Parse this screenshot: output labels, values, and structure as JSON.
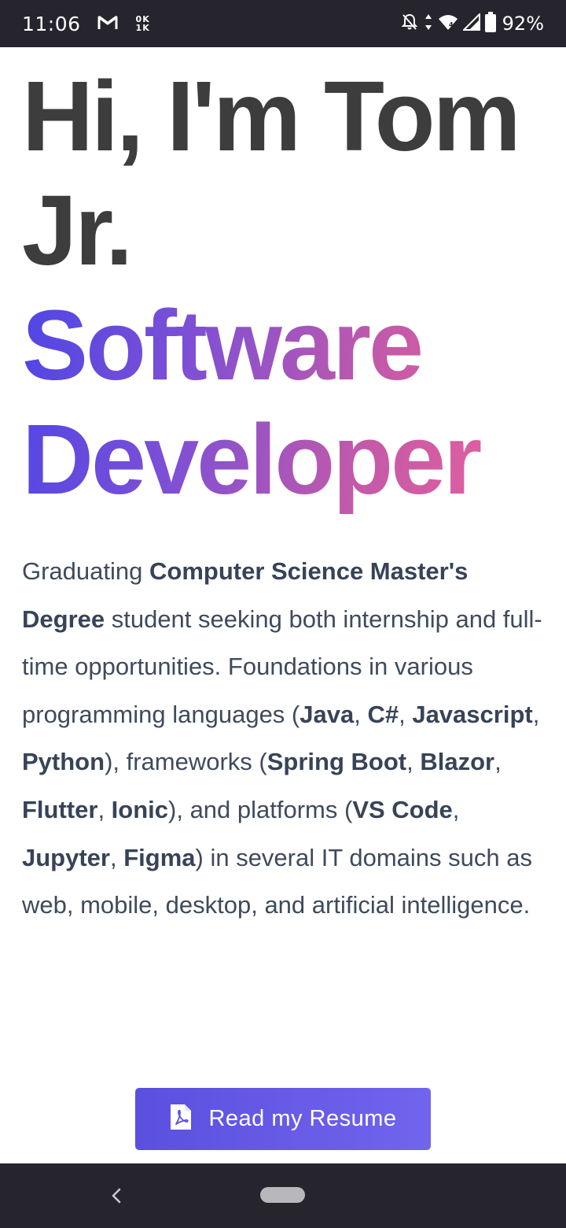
{
  "status_bar": {
    "time": "11:06",
    "left_icons": [
      "gmail-icon",
      "data-counter-icon"
    ],
    "data_counter": {
      "upload": "0K",
      "download": "1K"
    },
    "right_icons": [
      "notifications-off-icon",
      "data-transfer-icon",
      "wifi-icon",
      "cell-signal-icon",
      "battery-icon"
    ],
    "battery_percent": "92%"
  },
  "hero": {
    "title": "Hi, I'm Tom Jr.",
    "subtitle_line1": "Software",
    "subtitle_line2": "Developer",
    "gradient_colors": [
      "#4f46e5",
      "#7c4fd6",
      "#c45aa8",
      "#f0619a"
    ]
  },
  "intro": {
    "t1": "Graduating ",
    "b1": "Computer Science Master's Degree",
    "t2": " student seeking both internship and full-time opportunities. Foundations in various programming languages (",
    "b2": "Java",
    "t3": ", ",
    "b3": "C#",
    "t4": ", ",
    "b4": "Javascript",
    "t5": ", ",
    "b5": "Python",
    "t6": "), frameworks (",
    "b6": "Spring Boot",
    "t7": ", ",
    "b7": "Blazor",
    "t8": ", ",
    "b8": "Flutter",
    "t9": ", ",
    "b9": "Ionic",
    "t10": "), and platforms (",
    "b10": "VS Code",
    "t11": ", ",
    "b11": "Jupyter",
    "t12": ", ",
    "b12": "Figma",
    "t13": ") in several IT domains such as web, mobile, desktop, and artificial intelligence."
  },
  "resume_button": {
    "label": "Read my Resume",
    "icon": "pdf-file-icon",
    "color": "#5b4fe0"
  },
  "nav_bar": {
    "icons": [
      "back-icon",
      "home-pill-icon"
    ]
  },
  "colors": {
    "status_bar_bg": "#26252e",
    "title_text": "#3d3d3d",
    "body_text": "#3f4a5c",
    "page_bg": "#ffffff"
  }
}
